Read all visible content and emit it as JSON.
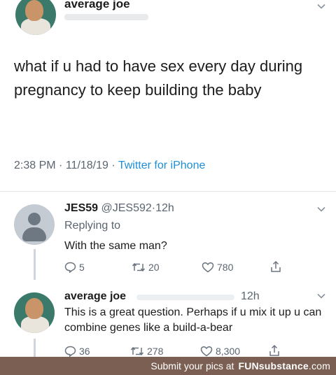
{
  "original_tweet": {
    "author_name": "average joe",
    "text": "what if u had to have sex every day during pregnancy to keep building the baby",
    "time": "2:38 PM",
    "date": "11/18/19",
    "source": "Twitter for iPhone",
    "separator": "·"
  },
  "reply_1": {
    "author_name": "JES59",
    "handle": "@JES592",
    "time": "12h",
    "separator": "·",
    "replying_to": "Replying to",
    "text": "With the same man?",
    "actions": {
      "replies": "5",
      "retweets": "20",
      "likes": "780"
    }
  },
  "reply_2": {
    "author_name": "average joe",
    "time": "12h",
    "text": "This is a great question. Perhaps if u mix it up u can combine genes like a build-a-bear",
    "actions": {
      "replies": "36",
      "retweets": "278",
      "likes": "8,300"
    }
  },
  "footer": {
    "prompt": "Submit your pics at",
    "brand": "FUNsubstance",
    "tld": ".com"
  },
  "colors": {
    "link": "#1d8fd8",
    "secondary_text": "#5b6570",
    "footer_bg": "#7a5f52"
  }
}
